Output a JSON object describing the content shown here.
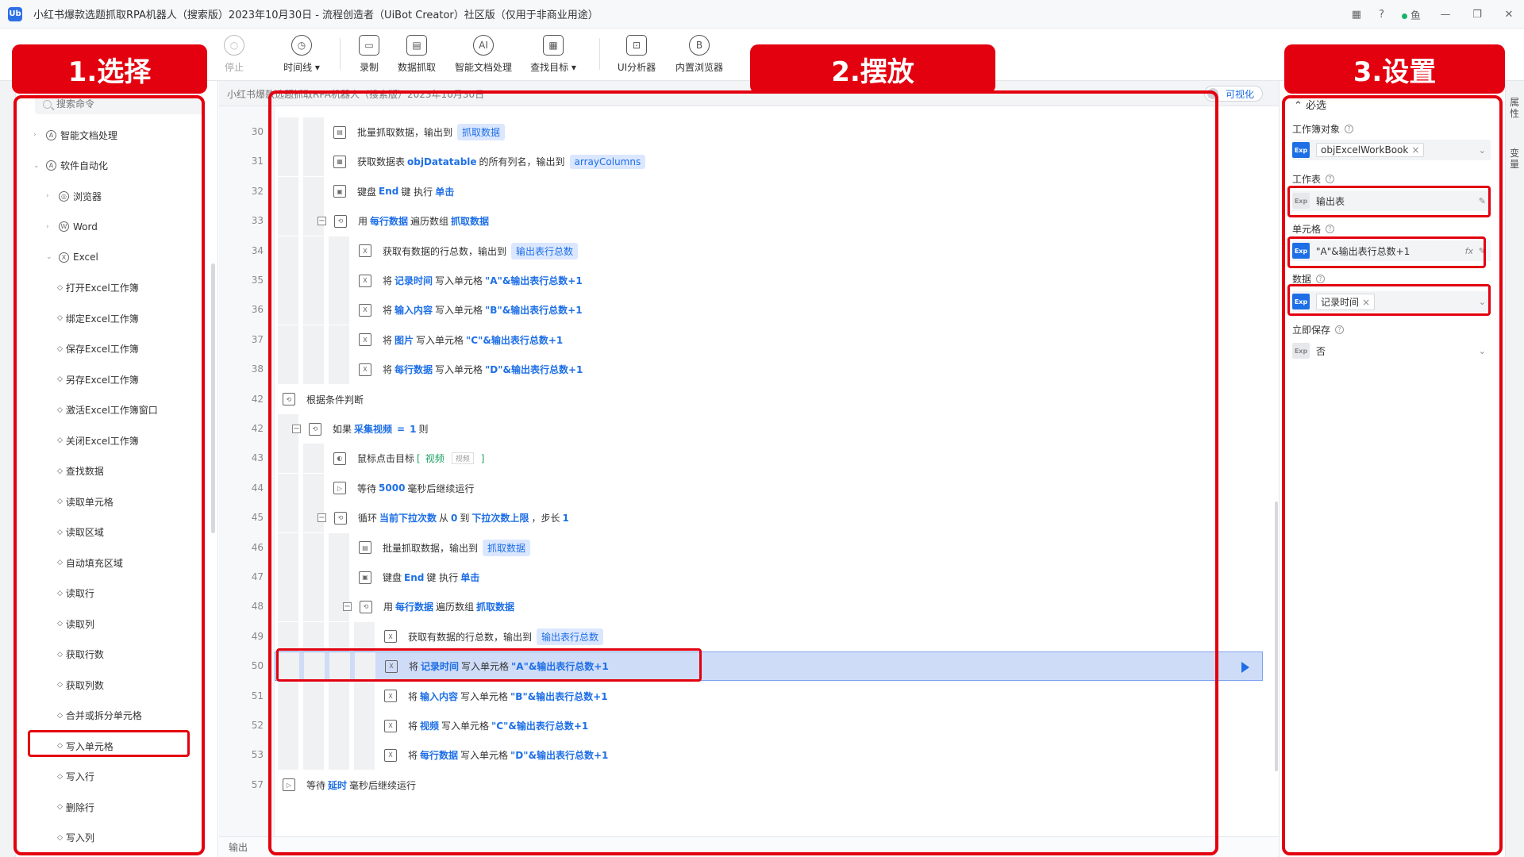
{
  "window": {
    "title": "小红书爆款选题抓取RPA机器人（搜索版）2023年10月30日 - 流程创造者（UiBot Creator）社区版（仅用于非商业用途）",
    "logo_text": "Ub",
    "right_user": "鱼",
    "grid_icon": "▦",
    "help_icon": "?",
    "min_icon": "—",
    "max_icon": "❐",
    "close_icon": "✕"
  },
  "toolbar": {
    "stop": "停止",
    "timeline": "时间线 ▾",
    "record": "录制",
    "data_capture": "数据抓取",
    "smart_doc": "智能文档处理",
    "find_target": "查找目标 ▾",
    "ui_analyzer": "UI分析器",
    "browser": "内置浏览器",
    "ticons": {
      "stop": "○",
      "timeline": "◷",
      "record": "▭",
      "data": "▤",
      "ai": "AI",
      "find": "▦",
      "ui": "⊡",
      "browser": "B"
    }
  },
  "left": {
    "search_placeholder": "搜索命令",
    "items": [
      {
        "label": "智能文档处理",
        "icon": "A",
        "arrow": "›"
      },
      {
        "label": "软件自动化",
        "icon": "A",
        "arrow": "⌄"
      },
      {
        "label": "浏览器",
        "icon": "◎",
        "arrow": "›"
      },
      {
        "label": "Word",
        "icon": "W",
        "arrow": "›"
      },
      {
        "label": "Excel",
        "icon": "X",
        "arrow": "⌄"
      },
      {
        "label": "打开Excel工作簿"
      },
      {
        "label": "绑定Excel工作簿"
      },
      {
        "label": "保存Excel工作簿"
      },
      {
        "label": "另存Excel工作簿"
      },
      {
        "label": "激活Excel工作簿窗口"
      },
      {
        "label": "关闭Excel工作簿"
      },
      {
        "label": "查找数据"
      },
      {
        "label": "读取单元格"
      },
      {
        "label": "读取区域"
      },
      {
        "label": "自动填充区域"
      },
      {
        "label": "读取行"
      },
      {
        "label": "读取列"
      },
      {
        "label": "获取行数"
      },
      {
        "label": "获取列数"
      },
      {
        "label": "合并或拆分单元格"
      },
      {
        "label": "写入单元格"
      },
      {
        "label": "写入行"
      },
      {
        "label": "删除行"
      },
      {
        "label": "写入列"
      }
    ],
    "bullet": "◇"
  },
  "center": {
    "breadcrumb": "小红书爆款选题抓取RPA机器人（搜索版）2023年10月30日",
    "visual_toggle": "可视化",
    "output_label": "输出",
    "lines": [
      "30",
      "31",
      "32",
      "33",
      "34",
      "35",
      "36",
      "37",
      "38",
      "42",
      "42",
      "43",
      "44",
      "45",
      "46",
      "47",
      "48",
      "49",
      "50",
      "51",
      "52",
      "53",
      "57"
    ],
    "rows": {
      "r30": {
        "a": "批量抓取数据，输出到",
        "p": "抓取数据"
      },
      "r31": {
        "a": "获取数据表",
        "k": "objDatatable",
        "b": "的所有列名，输出到",
        "p": "arrayColumns"
      },
      "r32": {
        "a": "键盘",
        "k": "End",
        "b": "键 执行",
        "k2": "单击"
      },
      "r33": {
        "a": "用",
        "k": "每行数据",
        "b": "遍历数组",
        "k2": "抓取数据"
      },
      "r34": {
        "a": "获取有数据的行总数，输出到",
        "p": "输出表行总数"
      },
      "r35": {
        "a": "将",
        "k": "记录时间",
        "b": "写入单元格",
        "k2": "\"A\"&输出表行总数+1"
      },
      "r36": {
        "a": "将",
        "k": "输入内容",
        "b": "写入单元格",
        "k2": "\"B\"&输出表行总数+1"
      },
      "r37": {
        "a": "将",
        "k": "图片",
        "b": "写入单元格",
        "k2": "\"C\"&输出表行总数+1"
      },
      "r38": {
        "a": "将",
        "k": "每行数据",
        "b": "写入单元格",
        "k2": "\"D\"&输出表行总数+1"
      },
      "r42a": {
        "a": "根据条件判断"
      },
      "r42b": {
        "a": "如果",
        "k": "采集视频",
        "b": "=",
        "k2": "1",
        "c": "则"
      },
      "r43": {
        "a": "鼠标点击目标",
        "g1": "[",
        "g2": "视频",
        "small": "视频",
        "g3": "]"
      },
      "r44": {
        "a": "等待",
        "k": "5000",
        "b": "毫秒后继续运行"
      },
      "r45": {
        "a": "循环",
        "k": "当前下拉次数",
        "b": "从",
        "k2": "0",
        "c": "到",
        "k3": "下拉次数上限",
        "d": "，步长",
        "k4": "1"
      },
      "r46": {
        "a": "批量抓取数据，输出到",
        "p": "抓取数据"
      },
      "r47": {
        "a": "键盘",
        "k": "End",
        "b": "键 执行",
        "k2": "单击"
      },
      "r48": {
        "a": "用",
        "k": "每行数据",
        "b": "遍历数组",
        "k2": "抓取数据"
      },
      "r49": {
        "a": "获取有数据的行总数，输出到",
        "p": "输出表行总数"
      },
      "r50": {
        "a": "将",
        "k": "记录时间",
        "b": "写入单元格",
        "k2": "\"A\"&输出表行总数+1"
      },
      "r51": {
        "a": "将",
        "k": "输入内容",
        "b": "写入单元格",
        "k2": "\"B\"&输出表行总数+1"
      },
      "r52": {
        "a": "将",
        "k": "视频",
        "b": "写入单元格",
        "k2": "\"C\"&输出表行总数+1"
      },
      "r53": {
        "a": "将",
        "k": "每行数据",
        "b": "写入单元格",
        "k2": "\"D\"&输出表行总数+1"
      },
      "r57": {
        "a": "等待",
        "k": "延时",
        "b": "毫秒后继续运行"
      }
    },
    "ricons": {
      "grab": "▤",
      "table": "▦",
      "key": "▣",
      "loop": "⟲",
      "excel": "X",
      "if": "⟲",
      "mouse": "◐",
      "wait": "▷"
    },
    "collapse_sign": "−"
  },
  "right": {
    "section": "⌃ 必选",
    "workbook_label": "工作簿对象",
    "workbook_value": "objExcelWorkBook",
    "sheet_label": "工作表",
    "sheet_value": "输出表",
    "cell_label": "单元格",
    "cell_value": "\"A\"&输出表行总数+1",
    "data_label": "数据",
    "data_value": "记录时间",
    "save_label": "立即保存",
    "save_value": "否",
    "exp": "Exp",
    "help": "?",
    "chevron": "⌄",
    "x": "×",
    "edit": "✎",
    "fx": "fx",
    "rail_top": "属性",
    "rail_bottom": "变量"
  },
  "annotations": {
    "label1": "1.选择",
    "label2": "2.摆放",
    "label3": "3.设置",
    "color": "#e3000f"
  }
}
